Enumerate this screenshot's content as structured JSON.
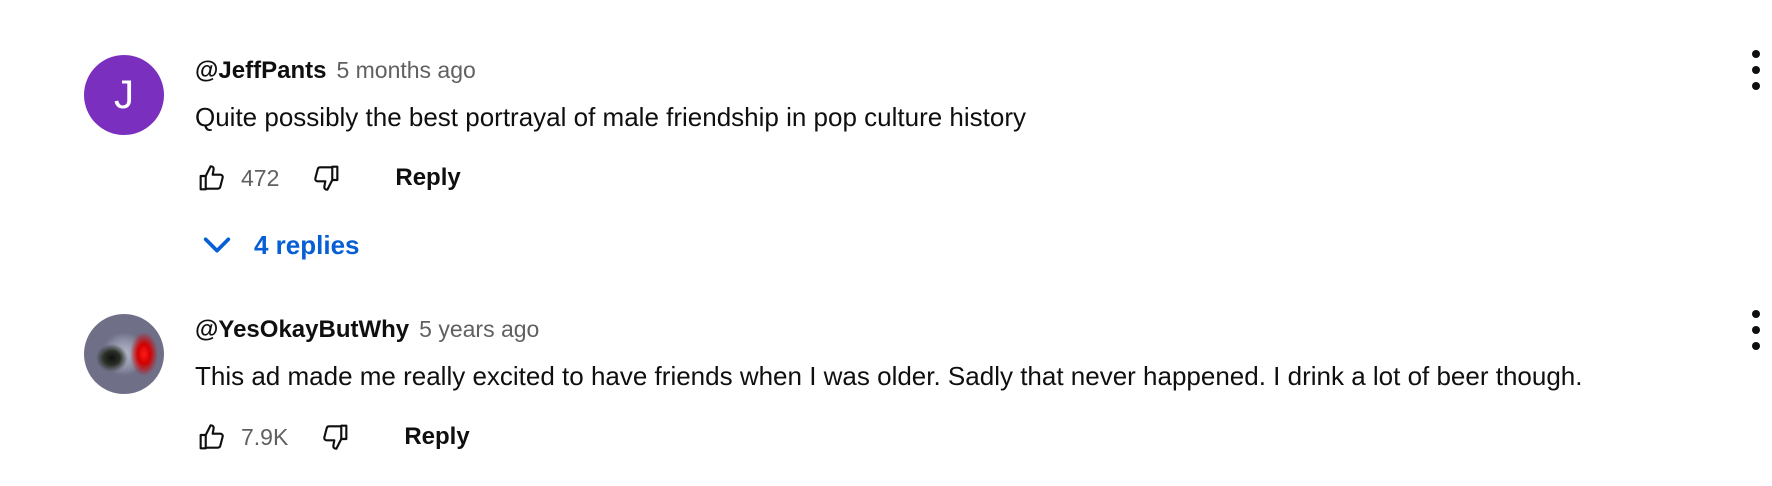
{
  "comments": [
    {
      "avatar_letter": "J",
      "avatar_color": "#7b2fbf",
      "author": "@JeffPants",
      "time": "5 months ago",
      "text": "Quite possibly the best portrayal of male friendship in pop culture history",
      "likes": "472",
      "reply_label": "Reply",
      "replies_label": "4 replies"
    },
    {
      "author": "@YesOkayButWhy",
      "time": "5 years ago",
      "text": "This ad made me really excited to have friends when I was older. Sadly that never happened. I drink a lot of beer though.",
      "likes": "7.9K",
      "reply_label": "Reply"
    }
  ],
  "colors": {
    "link_blue": "#065fd4",
    "secondary_text": "#606060",
    "primary_text": "#0f0f0f"
  },
  "icons": [
    "like-icon",
    "dislike-icon",
    "chevron-down-icon",
    "more-vert-icon"
  ]
}
